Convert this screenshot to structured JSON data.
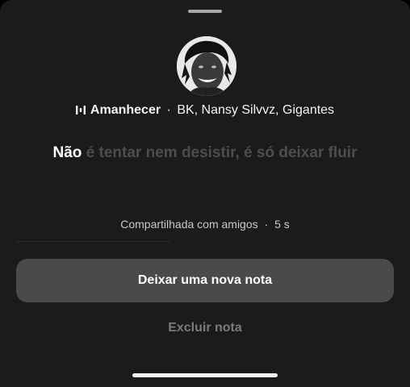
{
  "icons": {
    "music": "music-bars-icon",
    "avatar": "profile-photo"
  },
  "song": {
    "title": "Amanhecer",
    "separator": "·",
    "artists": "BK, Nansy Silvvz, Gigantes"
  },
  "lyrics": {
    "highlighted": "Não",
    "remaining": "é tentar nem desistir, é só deixar fluir"
  },
  "shared": {
    "text": "Compartilhada com amigos",
    "separator": "·",
    "time": "5 s"
  },
  "actions": {
    "new_note": "Deixar uma nova nota",
    "delete_note": "Excluir nota"
  },
  "colors": {
    "sheet_background": "#1b1b1b",
    "primary_button": "#4a4a4a",
    "lyric_active": "#ffffff",
    "lyric_inactive": "#4d4d4d",
    "secondary_text": "#7a7a7a"
  }
}
